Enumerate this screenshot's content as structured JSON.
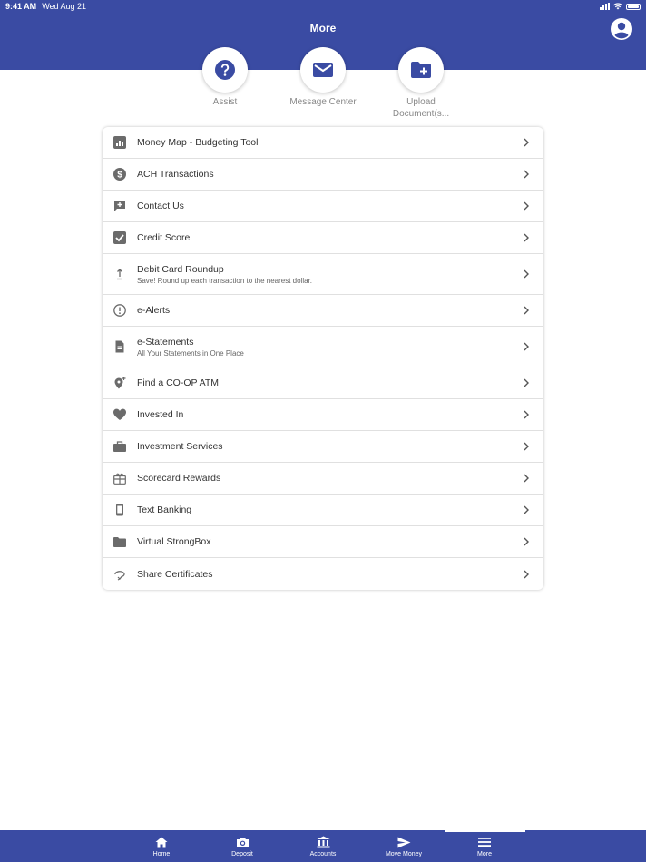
{
  "status_bar": {
    "time": "9:41 AM",
    "date": "Wed Aug 21"
  },
  "header": {
    "title": "More"
  },
  "quick_actions": [
    {
      "label": "Assist",
      "icon": "help-icon"
    },
    {
      "label": "Message Center",
      "icon": "mail-icon"
    },
    {
      "label": "Upload Document(s...",
      "icon": "folder-plus-icon"
    }
  ],
  "menu": [
    {
      "label": "Money Map - Budgeting Tool",
      "icon": "chart-icon"
    },
    {
      "label": "ACH Transactions",
      "icon": "dollar-icon"
    },
    {
      "label": "Contact Us",
      "icon": "chat-plus-icon"
    },
    {
      "label": "Credit Score",
      "icon": "checkbox-icon"
    },
    {
      "label": "Debit Card Roundup",
      "sub": "Save! Round up each transaction to the nearest dollar.",
      "icon": "roundup-icon"
    },
    {
      "label": "e-Alerts",
      "icon": "alert-icon"
    },
    {
      "label": "e-Statements",
      "sub": "All Your Statements in One Place",
      "icon": "document-icon"
    },
    {
      "label": "Find a CO-OP ATM",
      "icon": "location-icon"
    },
    {
      "label": "Invested In",
      "icon": "heart-icon"
    },
    {
      "label": "Investment Services",
      "icon": "briefcase-icon"
    },
    {
      "label": "Scorecard Rewards",
      "icon": "gift-icon"
    },
    {
      "label": "Text Banking",
      "icon": "phone-icon"
    },
    {
      "label": "Virtual StrongBox",
      "icon": "folder-icon"
    },
    {
      "label": "Share Certificates",
      "icon": "certificate-icon"
    }
  ],
  "tabbar": [
    {
      "label": "Home",
      "icon": "home-icon"
    },
    {
      "label": "Deposit",
      "icon": "camera-icon"
    },
    {
      "label": "Accounts",
      "icon": "bank-icon"
    },
    {
      "label": "Move Money",
      "icon": "send-icon"
    },
    {
      "label": "More",
      "icon": "menu-icon",
      "active": true
    }
  ],
  "colors": {
    "brand": "#3a4ba3",
    "icon_gray": "#6b6b6b"
  }
}
